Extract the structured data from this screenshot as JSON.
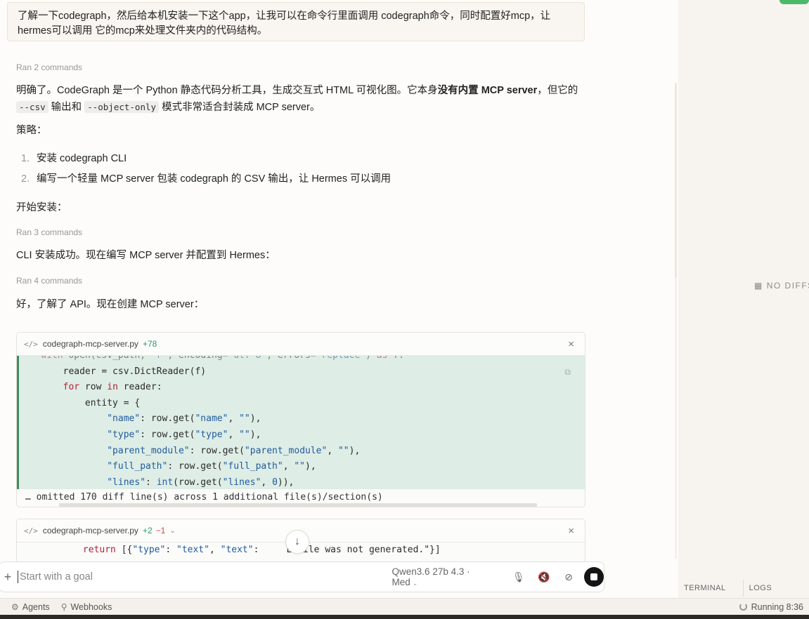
{
  "user_message": "了解一下codegraph，然后给本机安装一下这个app，让我可以在命令行里面调用 codegraph命令，同时配置好mcp，让hermes可以调用 它的mcp来处理文件夹内的代码结构。",
  "ran_1": "Ran 2 commands",
  "para_1_a": "明确了。CodeGraph 是一个 Python 静态代码分析工具，生成交互式 HTML 可视化图。它本身",
  "para_1_bold": "没有内置 MCP server",
  "para_1_b": "，但它的",
  "para_1_code_1": "--csv",
  "para_1_c": " 输出和 ",
  "para_1_code_2": "--object-only",
  "para_1_d": " 模式非常适合封装成 MCP server。",
  "strategy_label": "策略：",
  "steps": [
    {
      "num": "1.",
      "text": "安装 codegraph CLI"
    },
    {
      "num": "2.",
      "text": "编写一个轻量 MCP server 包装 codegraph 的 CSV 输出，让 Hermes 可以调用"
    }
  ],
  "start_install": "开始安装：",
  "ran_2": "Ran 3 commands",
  "cli_success": "CLI 安装成功。现在编写 MCP server 并配置到 Hermes：",
  "ran_3": "Ran 4 commands",
  "api_understood": "好，了解了 API。现在创建 MCP server：",
  "card1": {
    "filename": "codegraph-mcp-server.py",
    "added": "+78",
    "omitted": "… omitted 170 diff line(s) across 1 additional file(s)/section(s)"
  },
  "card2": {
    "filename": "codegraph-mcp-server.py",
    "added": "+2",
    "removed": "−1"
  },
  "composer": {
    "placeholder": "Start with a goal",
    "model": "Qwen3.6 27b 4.3 · Med"
  },
  "right_panel": {
    "no_diffs": "NO DIFFS",
    "tab_terminal": "TERMINAL",
    "tab_logs": "LOGS"
  },
  "statusbar": {
    "agents": "Agents",
    "webhooks": "Webhooks",
    "running": "Running",
    "time": "8:36"
  },
  "icons": {
    "code": "code-icon",
    "close": "close-icon",
    "copy": "copy-icon",
    "arrow_down": "arrow-down-icon",
    "plus": "plus-icon",
    "mic": "microphone-icon",
    "stop": "stop-icon"
  }
}
